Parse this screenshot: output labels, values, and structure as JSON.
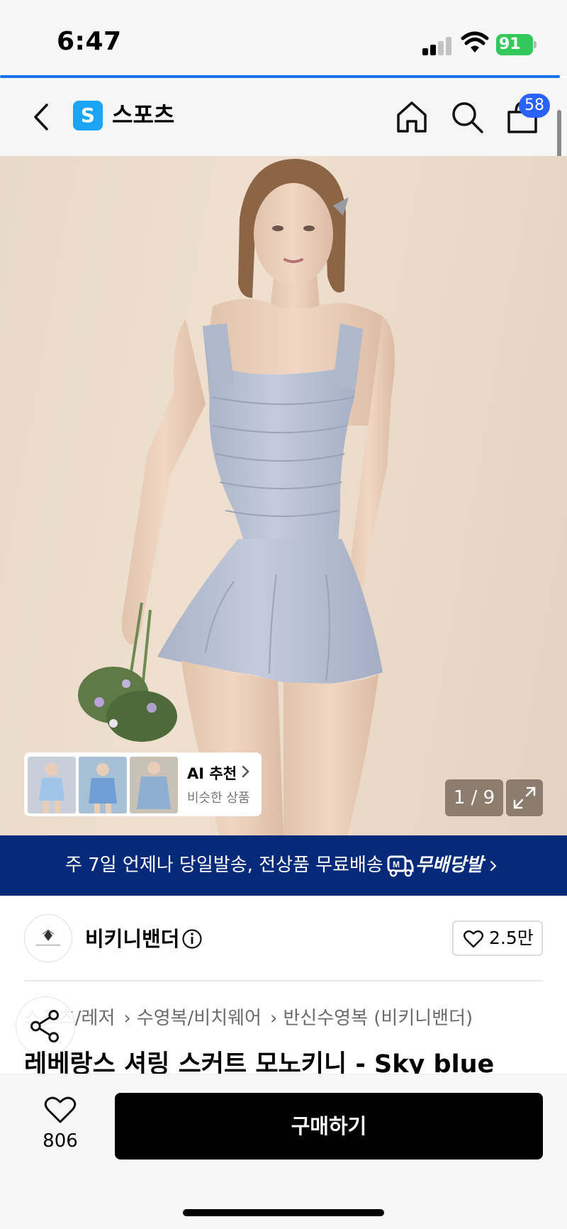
{
  "status_bar": {
    "time": "6:47",
    "battery": "91"
  },
  "nav": {
    "logo_letter": "S",
    "title": "스포츠",
    "cart_count": "58",
    "accent_color": "#2962ff"
  },
  "hero": {
    "ai_card": {
      "title": "AI 추천",
      "subtitle": "비슷한 상품"
    },
    "page_counter": "1 / 9"
  },
  "banner": {
    "text": "주 7일 언제나 당일발송, 전상품 무료배송",
    "brand": "무배당발",
    "background": "#062a7a"
  },
  "brand": {
    "name": "비키니밴더",
    "likes": "2.5만"
  },
  "breadcrumb": [
    "스포츠/레저",
    "수영복/비치웨어",
    "반신수영복 (비키니밴더)"
  ],
  "product": {
    "title": "레베랑스 셔링 스커트 모노키니 - Sky blue"
  },
  "bottom_bar": {
    "wish_count": "806",
    "buy_label": "구매하기"
  }
}
